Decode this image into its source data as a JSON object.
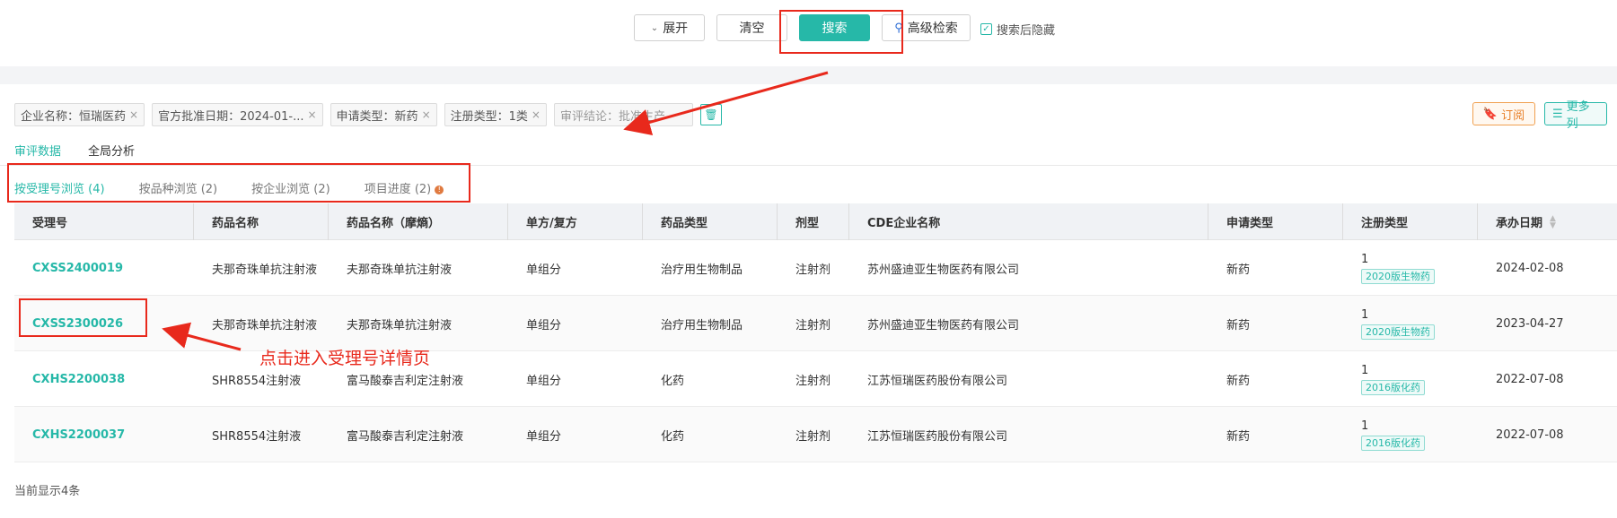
{
  "toolbar": {
    "expand_label": "展开",
    "clear_label": "清空",
    "search_label": "搜索",
    "advanced_label": "高级检索",
    "hide_after_search_label": "搜索后隐藏"
  },
  "filter_chips": [
    {
      "label": "企业名称：恒瑞医药"
    },
    {
      "label": "官方批准日期：2024-01-..."
    },
    {
      "label": "申请类型：新药"
    },
    {
      "label": "注册类型：1类"
    },
    {
      "label": "审评结论：批准生产"
    }
  ],
  "right_actions": {
    "subscribe_label": "订阅",
    "more_columns_label": "更多列"
  },
  "view_tabs": [
    {
      "label": "审评数据",
      "active": true
    },
    {
      "label": "全局分析",
      "active": false
    }
  ],
  "browse_tabs": [
    {
      "label": "按受理号浏览 (4)",
      "active": true
    },
    {
      "label": "按品种浏览 (2)",
      "active": false
    },
    {
      "label": "按企业浏览 (2)",
      "active": false
    },
    {
      "label": "项目进度 (2)",
      "active": false
    }
  ],
  "table": {
    "columns": [
      "受理号",
      "药品名称",
      "药品名称（摩熵）",
      "单方/复方",
      "药品类型",
      "剂型",
      "CDE企业名称",
      "申请类型",
      "注册类型",
      "承办日期"
    ],
    "rows": [
      {
        "acceptance_no": "CXSS2400019",
        "drug_name": "夫那奇珠单抗注射液",
        "drug_name_moshang": "夫那奇珠单抗注射液",
        "single_compound": "单组分",
        "drug_type": "治疗用生物制品",
        "dosage_form": "注射剂",
        "cde_company": "苏州盛迪亚生物医药有限公司",
        "application_type": "新药",
        "registration_class": "1",
        "registration_tag": "2020版生物药",
        "date": "2024-02-08"
      },
      {
        "acceptance_no": "CXSS2300026",
        "drug_name": "夫那奇珠单抗注射液",
        "drug_name_moshang": "夫那奇珠单抗注射液",
        "single_compound": "单组分",
        "drug_type": "治疗用生物制品",
        "dosage_form": "注射剂",
        "cde_company": "苏州盛迪亚生物医药有限公司",
        "application_type": "新药",
        "registration_class": "1",
        "registration_tag": "2020版生物药",
        "date": "2023-04-27"
      },
      {
        "acceptance_no": "CXHS2200038",
        "drug_name": "SHR8554注射液",
        "drug_name_moshang": "富马酸泰吉利定注射液",
        "single_compound": "单组分",
        "drug_type": "化药",
        "dosage_form": "注射剂",
        "cde_company": "江苏恒瑞医药股份有限公司",
        "application_type": "新药",
        "registration_class": "1",
        "registration_tag": "2016版化药",
        "date": "2022-07-08"
      },
      {
        "acceptance_no": "CXHS2200037",
        "drug_name": "SHR8554注射液",
        "drug_name_moshang": "富马酸泰吉利定注射液",
        "single_compound": "单组分",
        "drug_type": "化药",
        "dosage_form": "注射剂",
        "cde_company": "江苏恒瑞医药股份有限公司",
        "application_type": "新药",
        "registration_class": "1",
        "registration_tag": "2016版化药",
        "date": "2022-07-08"
      }
    ]
  },
  "footer": {
    "count_label": "当前显示4条"
  },
  "annotation": {
    "text": "点击进入受理号详情页",
    "color": "#e8291c"
  },
  "colors": {
    "accent": "#26b8a8",
    "annotation": "#e8291c",
    "subscribe": "#e8802a"
  }
}
